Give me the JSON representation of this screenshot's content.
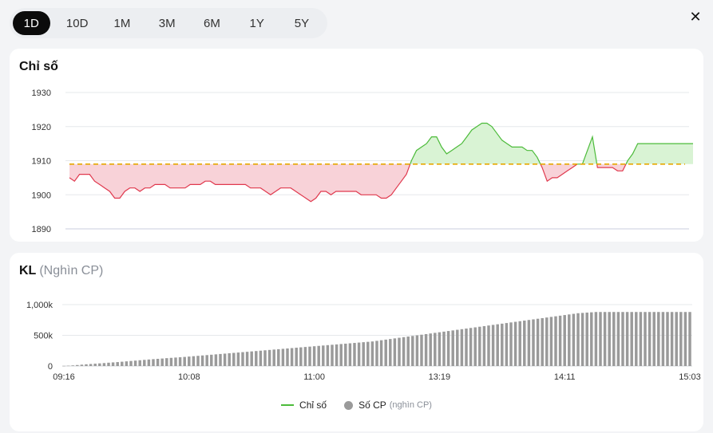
{
  "ranges": {
    "items": [
      {
        "label": "1D",
        "active": true
      },
      {
        "label": "10D"
      },
      {
        "label": "1M"
      },
      {
        "label": "3M"
      },
      {
        "label": "6M"
      },
      {
        "label": "1Y"
      },
      {
        "label": "5Y"
      }
    ]
  },
  "close_label": "✕",
  "price_panel": {
    "title": "Chỉ số"
  },
  "volume_panel": {
    "title": "KL",
    "unit": "(Nghìn CP)"
  },
  "legend": {
    "index_label": "Chỉ số",
    "volume_label": "Số CP",
    "volume_unit": "(nghìn CP)"
  },
  "colors": {
    "up": "#4cbb3a",
    "up_fill": "#d9f3d4",
    "down": "#e0394e",
    "down_fill": "#f8d2d8",
    "reference": "#e6a800",
    "volume_bar": "#9a9a9a",
    "grid": "#e6e8eb"
  },
  "chart_data": [
    {
      "type": "line",
      "title": "Chỉ số",
      "reference": 1909,
      "ylim": [
        1890,
        1930
      ],
      "yticks": [
        1890,
        1900,
        1910,
        1920,
        1930
      ],
      "grid": true,
      "values": [
        1905,
        1904,
        1906,
        1906,
        1906,
        1904,
        1903,
        1902,
        1901,
        1899,
        1899,
        1901,
        1902,
        1902,
        1901,
        1902,
        1902,
        1903,
        1903,
        1903,
        1902,
        1902,
        1902,
        1902,
        1903,
        1903,
        1903,
        1904,
        1904,
        1903,
        1903,
        1903,
        1903,
        1903,
        1903,
        1903,
        1902,
        1902,
        1902,
        1901,
        1900,
        1901,
        1902,
        1902,
        1902,
        1901,
        1900,
        1899,
        1898,
        1899,
        1901,
        1901,
        1900,
        1901,
        1901,
        1901,
        1901,
        1901,
        1900,
        1900,
        1900,
        1900,
        1899,
        1899,
        1900,
        1902,
        1904,
        1906,
        1910,
        1913,
        1914,
        1915,
        1917,
        1917,
        1914,
        1912,
        1913,
        1914,
        1915,
        1917,
        1919,
        1920,
        1921,
        1921,
        1920,
        1918,
        1916,
        1915,
        1914,
        1914,
        1914,
        1913,
        1913,
        1911,
        1908,
        1904,
        1905,
        1905,
        1906,
        1907,
        1908,
        1909,
        1909,
        1913,
        1917,
        1908,
        1908,
        1908,
        1908,
        1907,
        1907,
        1910,
        1912,
        1915,
        1915,
        1915,
        1915,
        1915,
        1915,
        1915,
        1915,
        1915,
        1915,
        1915,
        1915
      ]
    },
    {
      "type": "bar",
      "title": "KL",
      "ylabel": "(Nghìn CP)",
      "ylim": [
        0,
        1000
      ],
      "yticks": [
        {
          "v": 0,
          "label": "0"
        },
        {
          "v": 500,
          "label": "500k"
        },
        {
          "v": 1000,
          "label": "1,000k"
        }
      ],
      "xticks": [
        {
          "i": 0,
          "label": "09:16"
        },
        {
          "i": 26,
          "label": "10:08"
        },
        {
          "i": 52,
          "label": "11:00"
        },
        {
          "i": 78,
          "label": "13:19"
        },
        {
          "i": 104,
          "label": "14:11"
        },
        {
          "i": 130,
          "label": "15:03"
        }
      ],
      "series": [
        {
          "values": [
            2,
            5,
            10,
            16,
            22,
            28,
            33,
            38,
            43,
            48,
            54,
            59,
            64,
            70,
            76,
            82,
            88,
            94,
            100,
            106,
            112,
            117,
            122,
            128,
            133,
            138,
            143,
            148,
            154,
            160,
            166,
            172,
            178,
            184,
            190,
            196,
            202,
            208,
            214,
            220,
            226,
            232,
            238,
            244,
            250,
            256,
            262,
            268,
            274,
            280,
            286,
            292,
            298,
            304,
            310,
            316,
            322,
            328,
            334,
            340,
            346,
            352,
            358,
            364,
            370,
            376,
            382,
            388,
            394,
            400,
            410,
            420,
            430,
            440,
            450,
            460,
            470,
            480,
            490,
            500,
            510,
            520,
            530,
            540,
            550,
            560,
            570,
            580,
            590,
            600,
            610,
            620,
            630,
            640,
            650,
            660,
            670,
            680,
            690,
            700,
            710,
            720,
            730,
            740,
            750,
            760,
            770,
            780,
            790,
            800,
            810,
            820,
            830,
            840,
            850,
            860,
            865,
            870,
            875,
            880,
            880,
            880,
            880,
            880,
            880,
            880,
            880,
            880,
            880,
            880,
            880,
            880,
            880,
            880,
            880,
            880,
            880,
            880,
            880,
            880,
            880
          ]
        }
      ]
    }
  ]
}
